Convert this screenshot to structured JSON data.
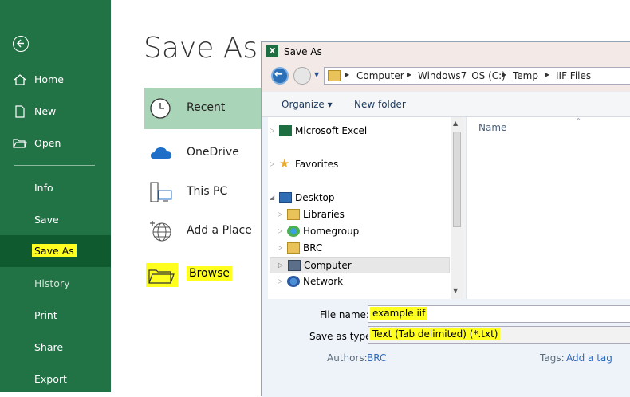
{
  "sidebar": {
    "back_icon": "back-arrow-circle-icon",
    "items": [
      {
        "label": "Home",
        "icon": "home-icon"
      },
      {
        "label": "New",
        "icon": "new-document-icon"
      },
      {
        "label": "Open",
        "icon": "open-folder-icon"
      },
      {
        "label": "Info"
      },
      {
        "label": "Save"
      },
      {
        "label": "Save As"
      },
      {
        "label": "History"
      },
      {
        "label": "Print"
      },
      {
        "label": "Share"
      },
      {
        "label": "Export"
      }
    ]
  },
  "main": {
    "title": "Save As",
    "locations": [
      {
        "label": "Recent",
        "icon": "clock-icon"
      },
      {
        "label": "OneDrive",
        "icon": "cloud-icon"
      },
      {
        "label": "This PC",
        "icon": "computer-icon"
      },
      {
        "label": "Add a Place",
        "icon": "globe-add-icon"
      },
      {
        "label": "Browse",
        "icon": "folder-icon"
      }
    ]
  },
  "dialog": {
    "title": "Save As",
    "app_badge": "X",
    "breadcrumb": [
      "Computer",
      "Windows7_OS (C:)",
      "Temp",
      "IIF Files"
    ],
    "toolbar": {
      "organize": "Organize ▾",
      "new_folder": "New folder"
    },
    "tree": [
      {
        "label": "Microsoft Excel",
        "icon": "excel-icon"
      },
      {
        "label": "Favorites",
        "icon": "star-icon"
      },
      {
        "label": "Desktop",
        "icon": "desktop-icon"
      },
      {
        "label": "Libraries",
        "icon": "libraries-icon"
      },
      {
        "label": "Homegroup",
        "icon": "homegroup-icon"
      },
      {
        "label": "BRC",
        "icon": "user-folder-icon"
      },
      {
        "label": "Computer",
        "icon": "computer-icon"
      },
      {
        "label": "Network",
        "icon": "network-icon"
      }
    ],
    "files_header": "Name",
    "file_name_label": "File name:",
    "file_name_value": "example.iif",
    "save_type_label": "Save as type:",
    "save_type_value": "Text (Tab delimited) (*.txt)",
    "authors_label": "Authors:",
    "authors_value": "BRC",
    "tags_label": "Tags:",
    "tags_value": "Add a tag"
  },
  "colors": {
    "sidebar": "#217346",
    "active": "#0f5a2f",
    "recent": "#a9d4b7",
    "highlight": "#ffff1f"
  }
}
